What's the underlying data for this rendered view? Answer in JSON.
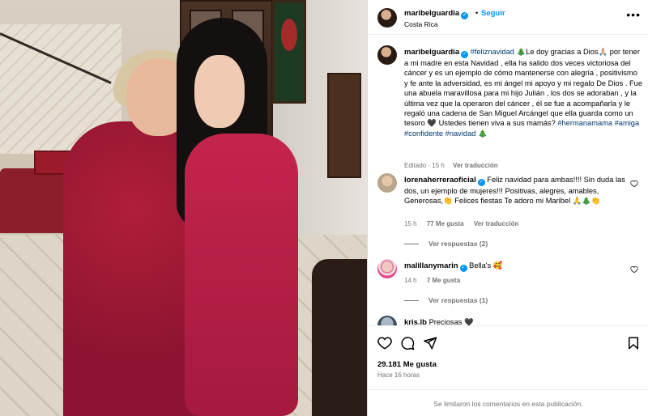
{
  "post": {
    "username": "maribelguardia",
    "follow_label": "Seguir",
    "separator": "•",
    "location": "Costa Rica",
    "more_label": "•••"
  },
  "caption": {
    "username": "maribelguardia",
    "hashtag1": "#feliznavidad",
    "text1": " 🎄Le doy gracias a Dios🙏🏼 por tener a mi madre en esta Navidad , ella ha salido dos veces victoriosa del cáncer y es un ejemplo de cómo mantenerse con alegría , positivismo y fe ante la adversidad, es mi ángel mi apoyo y mi regalo De Dios . Fue una abuela maravillosa para mi hijo Julián , los dos se adoraban , y la última vez que la operaron del cáncer , él se fue a acompañarla y le regaló una cadena de San Miguel Arcángel que ella guarda como un tesoro 🖤 Ustedes tienen viva a sus mamás? ",
    "hashtags": [
      "#hermanamama",
      "#amiga",
      "#confidente",
      "#navidad"
    ],
    "tree": "🎄",
    "edited": "Editado · 15 h",
    "translate": "Ver traducción"
  },
  "comments": [
    {
      "username": "lorenaherreraoficial",
      "text": " Feliz navidad para ambas!!!! Sin duda las dos, un ejemplo de mujeres!!! Positivas, alegres, amables, Generosas,👏 Felices fiestas Te adoro mi Maribel 🙏🎄👏",
      "time": "15 h",
      "likes": "77 Me gusta",
      "translate": "Ver traducción",
      "replies": "Ver respuestas (2)"
    },
    {
      "username": "malillanymarin",
      "text": " Bella's 🥰",
      "time": "14 h",
      "likes": "7 Me gusta",
      "replies": "Ver respuestas (1)"
    },
    {
      "username": "kris.lb",
      "text": " Preciosas 🖤"
    }
  ],
  "footer": {
    "likes": "29.181 Me gusta",
    "time_ago": "Hace 16 horas",
    "comments_closed": "Se limitaron los comentarios en esta publicación."
  },
  "icons": {
    "like": "heart-icon",
    "comment": "comment-icon",
    "share": "share-icon",
    "save": "bookmark-icon"
  }
}
